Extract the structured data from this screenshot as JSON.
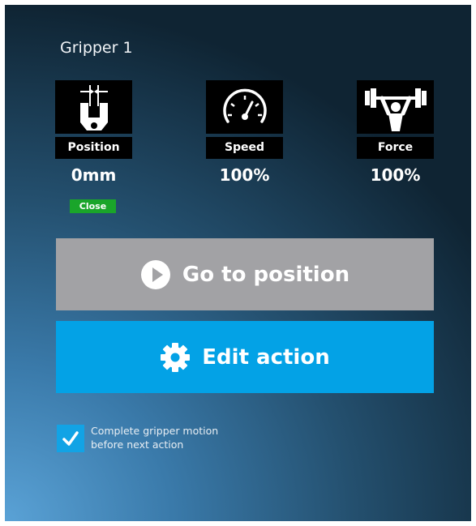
{
  "title": "Gripper 1",
  "params": {
    "position": {
      "label": "Position",
      "value": "0mm",
      "icon": "gripper-icon"
    },
    "speed": {
      "label": "Speed",
      "value": "100%",
      "icon": "speedometer-icon"
    },
    "force": {
      "label": "Force",
      "value": "100%",
      "icon": "weightlifter-icon"
    }
  },
  "status_badge": "Close",
  "buttons": {
    "go": {
      "label": "Go to position",
      "icon": "play-circle-icon"
    },
    "edit": {
      "label": "Edit action",
      "icon": "gear-icon"
    }
  },
  "checkbox": {
    "checked": true,
    "line1": "Complete gripper motion",
    "line2": "before next action"
  },
  "colors": {
    "go_button": "#a2a2a5",
    "edit_button": "#03a2e6",
    "badge": "#1aa52a",
    "checkbox": "#12a3e5"
  }
}
